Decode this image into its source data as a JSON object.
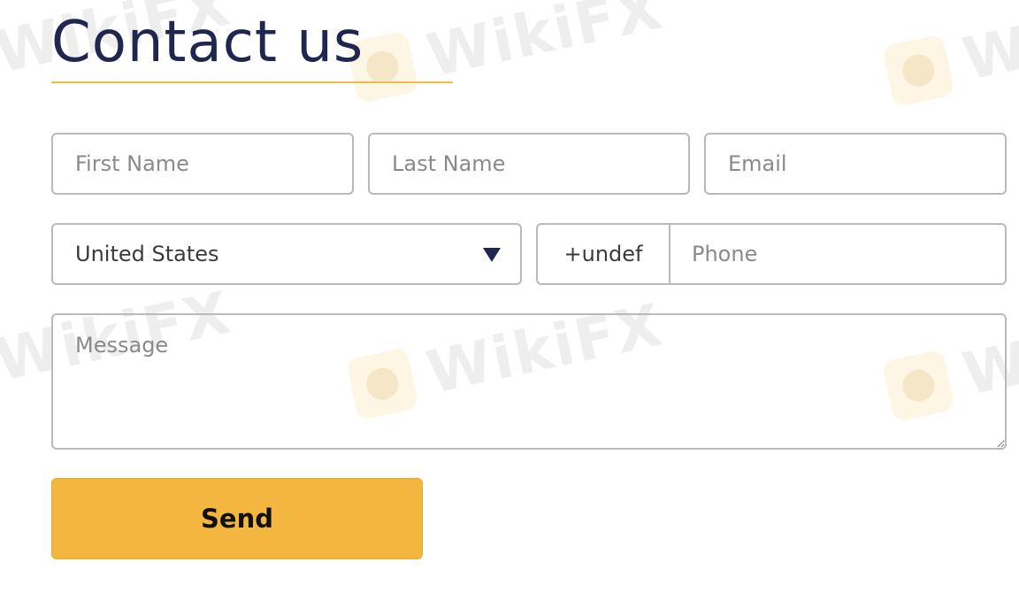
{
  "page": {
    "title": "Contact us",
    "accent_color": "#efbe47",
    "title_color": "#1f2650"
  },
  "form": {
    "first_name": {
      "placeholder": "First Name",
      "value": ""
    },
    "last_name": {
      "placeholder": "Last Name",
      "value": ""
    },
    "email": {
      "placeholder": "Email",
      "value": ""
    },
    "country": {
      "selected": "United States",
      "icon": "chevron-down-icon"
    },
    "phone": {
      "code": "+undef",
      "placeholder": "Phone",
      "value": ""
    },
    "message": {
      "placeholder": "Message",
      "value": ""
    },
    "submit": {
      "label": "Send",
      "color": "#f3b63f"
    }
  },
  "watermark": {
    "text": "WikiFX",
    "icon": "wikifx-logo-icon"
  }
}
